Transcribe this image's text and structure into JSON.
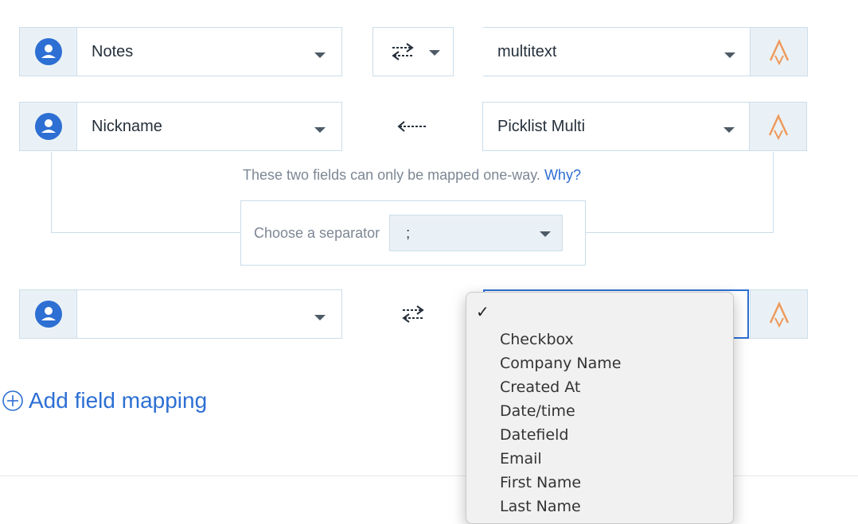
{
  "rows": [
    {
      "left_field": "Notes",
      "direction": "two-way",
      "right_field": "multitext"
    },
    {
      "left_field": "Nickname",
      "direction": "one-way-left",
      "right_field": "Picklist Multi"
    },
    {
      "left_field": "",
      "direction": "two-way",
      "right_field": ""
    }
  ],
  "notice": {
    "text": "These two fields can only be mapped one-way.",
    "link": "Why?"
  },
  "separator": {
    "label": "Choose a separator",
    "value": ";"
  },
  "add_mapping": "Add field mapping",
  "dropdown": {
    "checkmark": "✓",
    "options": [
      "Checkbox",
      "Company Name",
      "Created At",
      "Date/time",
      "Datefield",
      "Email",
      "First Name",
      "Last Name"
    ]
  },
  "colors": {
    "accent": "#2d6fd3",
    "app_icon": "#ee9a5c",
    "border": "#cbdde9",
    "panel": "#eaf1f6"
  },
  "icons": {
    "left_app": "user-circle-icon",
    "right_app": "app-logo-icon",
    "sync": "two-way-arrows-icon",
    "one_way": "left-arrow-icon",
    "add": "plus-circle-icon"
  }
}
